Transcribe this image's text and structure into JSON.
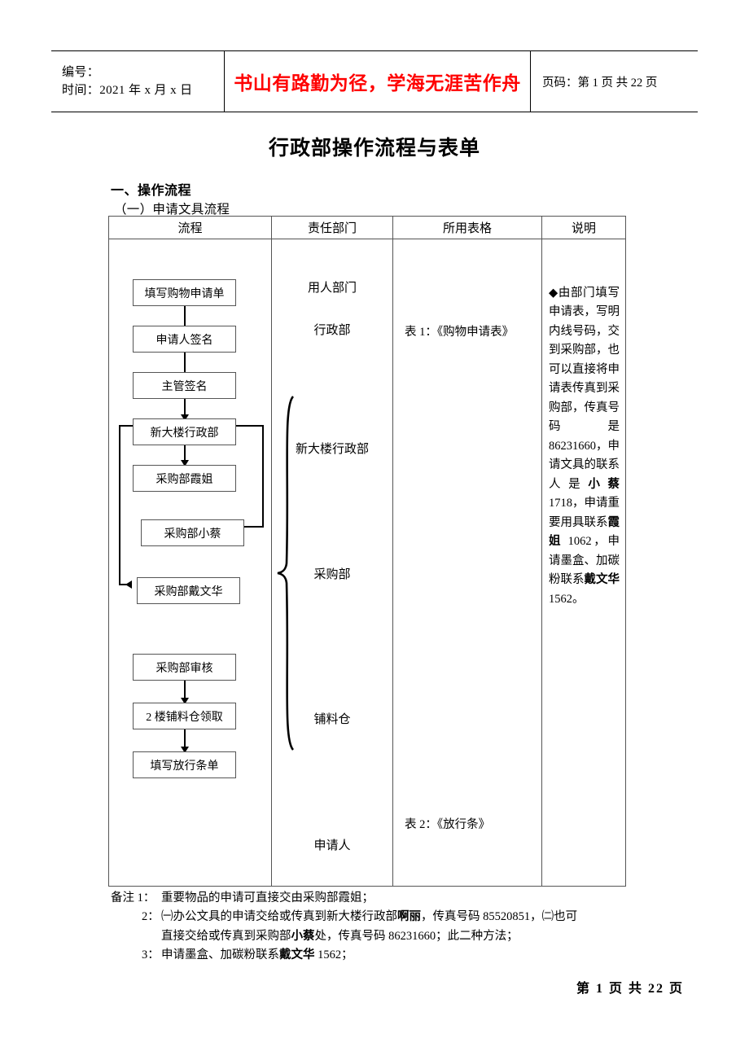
{
  "header": {
    "number_label": "编号：",
    "time_label": "时间：2021 年 x 月 x 日",
    "motto": "书山有路勤为径，学海无涯苦作舟",
    "page_label": "页码：第 1 页  共 22 页"
  },
  "title": "行政部操作流程与表单",
  "section": {
    "h1": "一、操作流程",
    "h2": "（一）申请文具流程"
  },
  "table": {
    "columns": [
      "流程",
      "责任部门",
      "所用表格",
      "说明"
    ],
    "flow_steps": [
      "填写购物申请单",
      "申请人签名",
      "主管签名",
      "新大楼行政部",
      "采购部霞姐",
      "采购部小蔡",
      "采购部戴文华",
      "采购部审核",
      "2 楼铺料仓领取",
      "填写放行条单"
    ],
    "departments": [
      "用人部门",
      "行政部",
      "新大楼行政部",
      "采购部",
      "铺料仓",
      "申请人"
    ],
    "forms": [
      "表 1：《购物申请表》",
      "表 2：《放行条》"
    ],
    "note_parts": [
      {
        "text": "◆由部门填写申请表，写明内线号码，交到采购部，也可以直接将申请表传真到采购部，传真号码是 86231660，申请文具的联系人是",
        "bold": false
      },
      {
        "text": "小蔡",
        "bold": true
      },
      {
        "text": " 1718，申请重要用具联系",
        "bold": false
      },
      {
        "text": "霞姐",
        "bold": true
      },
      {
        "text": " 1062，申请墨盒、加碳粉联系",
        "bold": false
      },
      {
        "text": "戴文华",
        "bold": true
      },
      {
        "text": " 1562。",
        "bold": false
      }
    ]
  },
  "remarks": {
    "label": "备注",
    "items": [
      {
        "num": "1：",
        "lines": [
          [
            {
              "text": "重要物品的申请可直接交由采购部霞姐；",
              "bold": false
            }
          ]
        ]
      },
      {
        "num": "2：",
        "lines": [
          [
            {
              "text": "㈠办公文具的申请交给或传真到新大楼行政部",
              "bold": false
            },
            {
              "text": "啊丽",
              "bold": true
            },
            {
              "text": "，传真号码 85520851，㈡也可",
              "bold": false
            }
          ],
          [
            {
              "text": "直接交给或传真到采购部",
              "bold": false
            },
            {
              "text": "小蔡",
              "bold": true
            },
            {
              "text": "处，传真号码 86231660；此二种方法；",
              "bold": false
            }
          ]
        ]
      },
      {
        "num": "3：",
        "lines": [
          [
            {
              "text": "申请墨盒、加碳粉联系",
              "bold": false
            },
            {
              "text": "戴文华",
              "bold": true
            },
            {
              "text": " 1562；",
              "bold": false
            }
          ]
        ]
      }
    ]
  },
  "footer": {
    "page_text": "第 1 页 共 22 页"
  },
  "colors": {
    "motto_red": "#ff0000",
    "rule": "#000000",
    "table_border": "#555555"
  }
}
